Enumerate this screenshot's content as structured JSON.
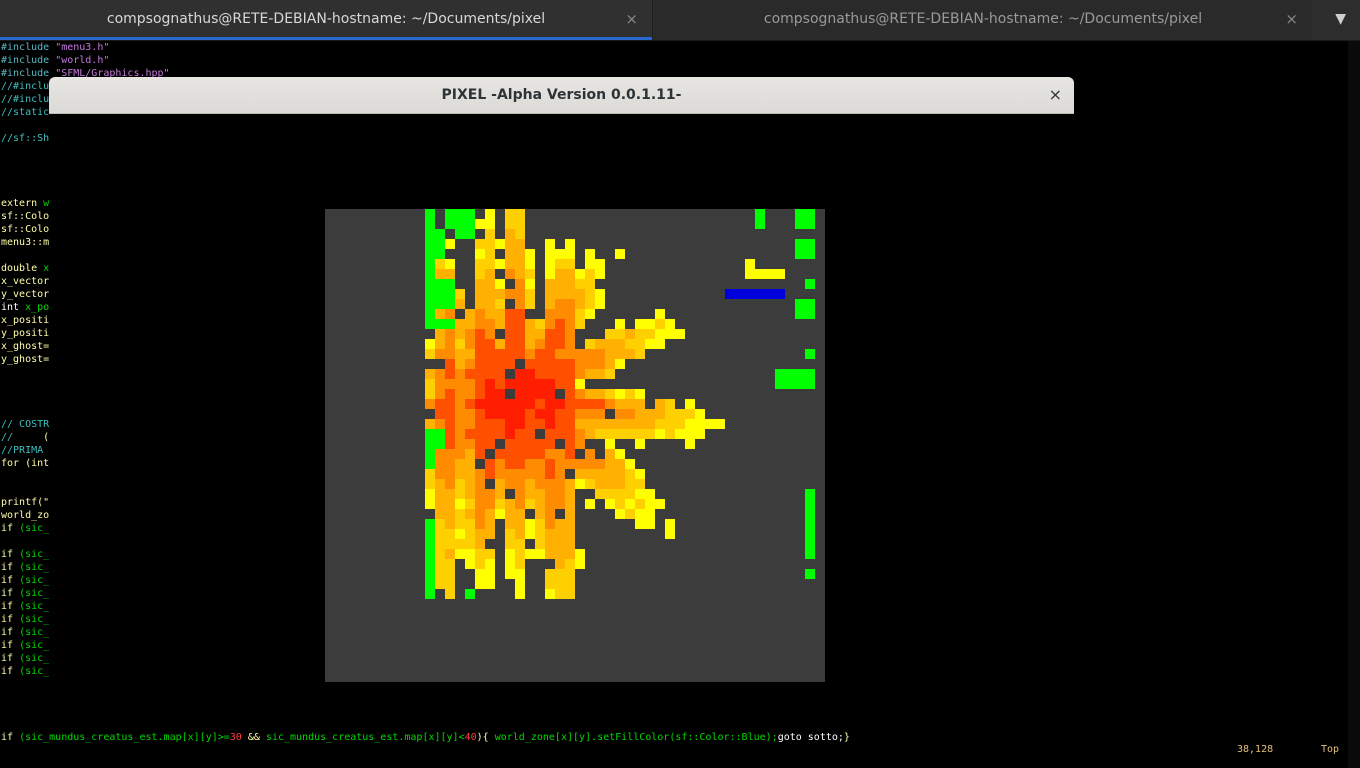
{
  "tabs": [
    {
      "label": "compsognathus@RETE-DEBIAN-hostname: ~/Documents/pixel",
      "close": "×",
      "active": true
    },
    {
      "label": "compsognathus@RETE-DEBIAN-hostname: ~/Documents/pixel",
      "close": "×",
      "active": false
    }
  ],
  "tab_menu_icon": "chevron-down-icon",
  "tab_menu_glyph": "▼",
  "window": {
    "title": "PIXEL -Alpha Version 0.0.1.11-",
    "close": "×"
  },
  "code_lines": [
    [
      [
        "#include ",
        "m"
      ],
      [
        "\"menu3.h\"",
        "s"
      ]
    ],
    [
      [
        "#include ",
        "m"
      ],
      [
        "\"world.h\"",
        "s"
      ]
    ],
    [
      [
        "#include ",
        "m"
      ],
      [
        "\"SFML/Graphics.hpp\"",
        "s"
      ]
    ],
    [
      [
        "//#inclu",
        "c"
      ]
    ],
    [
      [
        "//#inclu",
        "c"
      ]
    ],
    [
      [
        "//static",
        "c"
      ]
    ],
    [
      [
        "",
        ""
      ]
    ],
    [
      [
        "//sf::Sh",
        "c"
      ]
    ],
    [
      [
        "",
        ""
      ]
    ],
    [
      [
        "",
        ""
      ]
    ],
    [
      [
        "",
        ""
      ]
    ],
    [
      [
        "",
        ""
      ]
    ],
    [
      [
        "extern ",
        "y"
      ],
      [
        "w",
        "g"
      ]
    ],
    [
      [
        "sf::Colo",
        "y"
      ]
    ],
    [
      [
        "sf::Colo",
        "y"
      ]
    ],
    [
      [
        "menu3::m",
        "y"
      ]
    ],
    [
      [
        "",
        ""
      ]
    ],
    [
      [
        "double ",
        "y"
      ],
      [
        "x",
        "g"
      ]
    ],
    [
      [
        "x_vector",
        "y"
      ]
    ],
    [
      [
        "y_vector",
        "y"
      ]
    ],
    [
      [
        "int ",
        "w"
      ],
      [
        "x_po",
        "g"
      ]
    ],
    [
      [
        "x_positi",
        "y"
      ]
    ],
    [
      [
        "y_positi",
        "y"
      ]
    ],
    [
      [
        "x_ghost=",
        "y"
      ]
    ],
    [
      [
        "y_ghost=",
        "y"
      ]
    ],
    [
      [
        "",
        ""
      ]
    ],
    [
      [
        "",
        ""
      ]
    ],
    [
      [
        "",
        ""
      ]
    ],
    [
      [
        "",
        ""
      ]
    ],
    [
      [
        "// COSTR",
        "c"
      ]
    ],
    [
      [
        "//     ",
        "c"
      ],
      [
        "(",
        "y"
      ]
    ],
    [
      [
        "//PRIMA ",
        "c"
      ],
      [
        "(",
        "y"
      ]
    ],
    [
      [
        "for ",
        "y"
      ],
      [
        "(int",
        "y"
      ]
    ],
    [
      [
        "",
        ""
      ]
    ],
    [
      [
        "",
        ""
      ]
    ],
    [
      [
        "printf(\"",
        "y"
      ]
    ],
    [
      [
        "world_zo",
        "y"
      ]
    ],
    [
      [
        "if ",
        "y"
      ],
      [
        "(sic_",
        "g"
      ]
    ],
    [
      [
        "",
        ""
      ]
    ],
    [
      [
        "if ",
        "y"
      ],
      [
        "(sic_",
        "g"
      ]
    ],
    [
      [
        "if ",
        "y"
      ],
      [
        "(sic_",
        "g"
      ]
    ],
    [
      [
        "if ",
        "y"
      ],
      [
        "(sic_",
        "g"
      ]
    ],
    [
      [
        "if ",
        "y"
      ],
      [
        "(sic_",
        "g"
      ]
    ],
    [
      [
        "if ",
        "y"
      ],
      [
        "(sic_",
        "g"
      ]
    ],
    [
      [
        "if ",
        "y"
      ],
      [
        "(sic_",
        "g"
      ]
    ],
    [
      [
        "if ",
        "y"
      ],
      [
        "(sic_",
        "g"
      ]
    ],
    [
      [
        "if ",
        "y"
      ],
      [
        "(sic_",
        "g"
      ]
    ],
    [
      [
        "if ",
        "y"
      ],
      [
        "(sic_",
        "g"
      ]
    ],
    [
      [
        "if ",
        "y"
      ],
      [
        "(sic_",
        "g"
      ]
    ]
  ],
  "bottom_line": [
    [
      "if ",
      "y"
    ],
    [
      "(sic_mundus_creatus_est.map[x][y]>=",
      "g"
    ],
    [
      "30",
      "r"
    ],
    [
      " && ",
      "y"
    ],
    [
      "sic_mundus_creatus_est.map[x][y]<",
      "g"
    ],
    [
      "40",
      "r"
    ],
    [
      "){ ",
      "y"
    ],
    [
      "world_zone[x][y].setFillColor(sf::Color::Blue);",
      "g"
    ],
    [
      "goto sotto;",
      "w"
    ],
    [
      "}",
      "y"
    ]
  ],
  "status": {
    "position": "38,128",
    "scroll": "Top"
  },
  "colors": {
    "terminal_bg": "#000000",
    "tab_accent": "#2a6ad0",
    "world_bg": "#3c3c3c",
    "green": "#00ff00",
    "blue": "#0000dd",
    "yellow": "#ffff00",
    "gold": "#ffd000",
    "amber": "#ffb000",
    "orange": "#ff8c00",
    "redorange": "#ff5000",
    "red": "#ff1e00"
  }
}
